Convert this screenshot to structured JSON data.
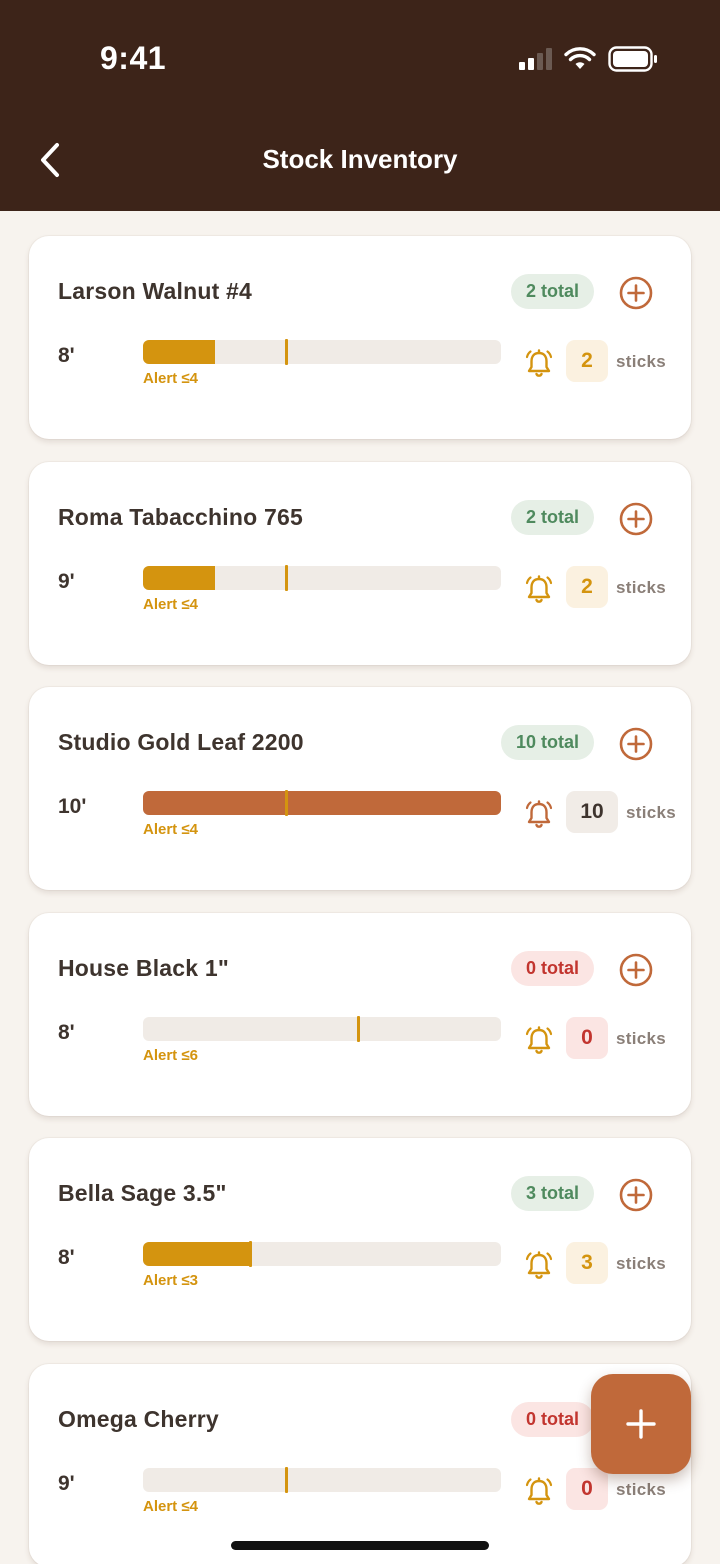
{
  "status_bar": {
    "time": "9:41"
  },
  "nav": {
    "title": "Stock Inventory"
  },
  "sticks_label": "sticks",
  "colors": {
    "header_bg": "#3d2419",
    "accent": "#c0693a",
    "alert": "#d4940f",
    "ok_green": "#4f8a5e",
    "zero_red": "#c2352f"
  },
  "items": [
    {
      "name": "Larson Walnut #4",
      "total": "2 total",
      "status": "low",
      "length": "8'",
      "alert": "Alert ≤4",
      "count": "2",
      "fill_fraction": 0.2,
      "alert_fraction": 0.4
    },
    {
      "name": "Roma Tabacchino 765",
      "total": "2 total",
      "status": "low",
      "length": "9'",
      "alert": "Alert ≤4",
      "count": "2",
      "fill_fraction": 0.2,
      "alert_fraction": 0.4
    },
    {
      "name": "Studio Gold Leaf 2200",
      "total": "10 total",
      "status": "ok",
      "length": "10'",
      "alert": "Alert ≤4",
      "count": "10",
      "fill_fraction": 1.0,
      "alert_fraction": 0.4
    },
    {
      "name": "House Black 1\"",
      "total": "0 total",
      "status": "zero",
      "length": "8'",
      "alert": "Alert ≤6",
      "count": "0",
      "fill_fraction": 0.0,
      "alert_fraction": 0.6
    },
    {
      "name": "Bella Sage 3.5\"",
      "total": "3 total",
      "status": "low",
      "length": "8'",
      "alert": "Alert ≤3",
      "count": "3",
      "fill_fraction": 0.3,
      "alert_fraction": 0.3
    },
    {
      "name": "Omega Cherry",
      "total": "0 total",
      "status": "zero",
      "length": "9'",
      "alert": "Alert ≤4",
      "count": "0",
      "fill_fraction": 0.0,
      "alert_fraction": 0.4
    }
  ],
  "icons": {
    "back": "chevron-left-icon",
    "add_item": "plus-circle-icon",
    "alert": "bell-icon",
    "fab": "plus-icon"
  }
}
